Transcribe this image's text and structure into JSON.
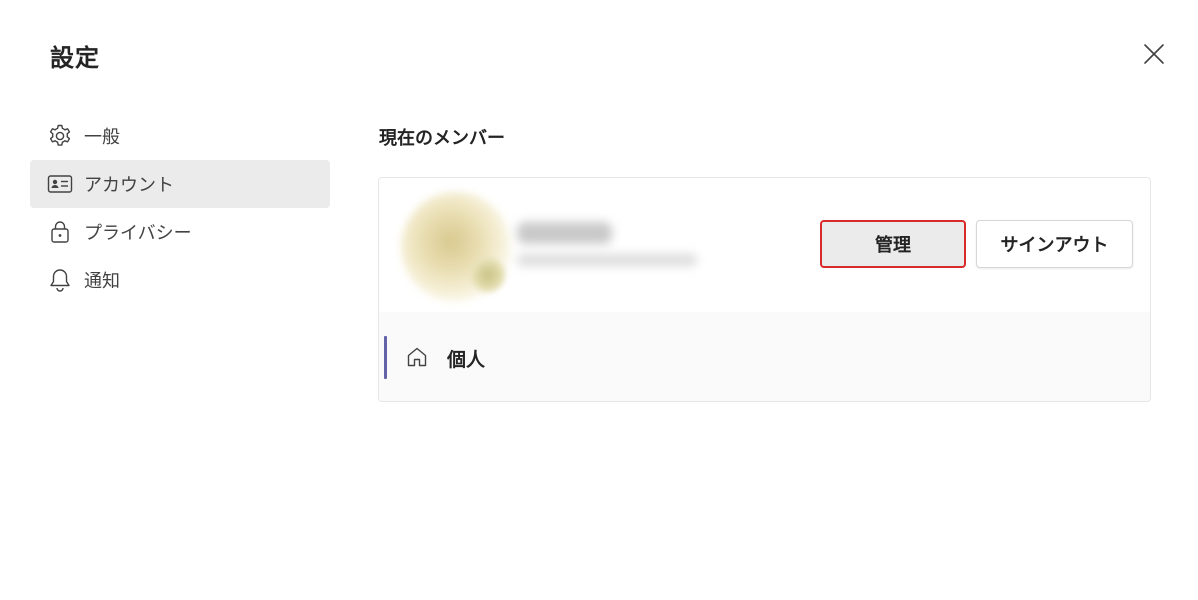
{
  "dialog": {
    "title": "設定"
  },
  "sidebar": {
    "items": [
      {
        "label": "一般",
        "icon": "gear-icon",
        "active": false
      },
      {
        "label": "アカウント",
        "icon": "id-card-icon",
        "active": true
      },
      {
        "label": "プライバシー",
        "icon": "lock-icon",
        "active": false
      },
      {
        "label": "通知",
        "icon": "bell-icon",
        "active": false
      }
    ]
  },
  "main": {
    "section_title": "現在のメンバー",
    "account_card": {
      "manage_label": "管理",
      "signout_label": "サインアウト",
      "tenant": {
        "label": "個人",
        "icon": "home-icon"
      }
    }
  },
  "colors": {
    "accent": "#6264a7",
    "highlight_border": "#d92a2a",
    "active_nav_bg": "#ebebeb"
  }
}
